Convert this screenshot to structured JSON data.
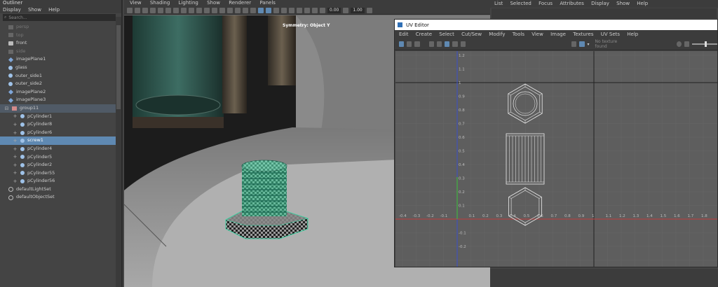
{
  "outliner": {
    "title": "Outliner",
    "menu": [
      "Display",
      "Show",
      "Help"
    ],
    "search_placeholder": "Search...",
    "items": [
      {
        "label": "persp",
        "icon": "camera-icon",
        "state": "dim",
        "indent": 1
      },
      {
        "label": "top",
        "icon": "camera-icon",
        "state": "dim",
        "indent": 1
      },
      {
        "label": "front",
        "icon": "camera-icon",
        "state": "normal",
        "indent": 1
      },
      {
        "label": "side",
        "icon": "camera-icon",
        "state": "dim",
        "indent": 1
      },
      {
        "label": "imagePlane1",
        "icon": "image-plane-icon",
        "state": "normal",
        "indent": 1
      },
      {
        "label": "glass",
        "icon": "mesh-icon",
        "state": "normal",
        "indent": 1
      },
      {
        "label": "outer_side1",
        "icon": "mesh-icon",
        "state": "normal",
        "indent": 1
      },
      {
        "label": "outer_side2",
        "icon": "mesh-icon",
        "state": "normal",
        "indent": 1
      },
      {
        "label": "imagePlane2",
        "icon": "image-plane-icon",
        "state": "normal",
        "indent": 1
      },
      {
        "label": "imagePlane3",
        "icon": "image-plane-icon",
        "state": "normal",
        "indent": 1
      },
      {
        "label": "group11",
        "icon": "group-icon",
        "state": "highlight",
        "indent": 0
      },
      {
        "label": "pCylinder1",
        "icon": "mesh-icon",
        "state": "normal",
        "indent": 2
      },
      {
        "label": "pCylinder8",
        "icon": "mesh-icon",
        "state": "normal",
        "indent": 2
      },
      {
        "label": "pCylinder6",
        "icon": "mesh-icon",
        "state": "normal",
        "indent": 2
      },
      {
        "label": "screw1",
        "icon": "mesh-icon",
        "state": "selected",
        "indent": 2
      },
      {
        "label": "pCylinder4",
        "icon": "mesh-icon",
        "state": "normal",
        "indent": 2
      },
      {
        "label": "pCylinder5",
        "icon": "mesh-icon",
        "state": "normal",
        "indent": 2
      },
      {
        "label": "pCylinder2",
        "icon": "mesh-icon",
        "state": "normal",
        "indent": 2
      },
      {
        "label": "pCylinder55",
        "icon": "mesh-icon",
        "state": "normal",
        "indent": 2
      },
      {
        "label": "pCylinder56",
        "icon": "mesh-icon",
        "state": "normal",
        "indent": 2
      },
      {
        "label": "defaultLightSet",
        "icon": "set-icon",
        "state": "normal",
        "indent": 1
      },
      {
        "label": "defaultObjectSet",
        "icon": "set-icon",
        "state": "normal",
        "indent": 1
      }
    ]
  },
  "viewport": {
    "menu": [
      "View",
      "Shading",
      "Lighting",
      "Show",
      "Renderer",
      "Panels"
    ],
    "field_a": "0.00",
    "field_b": "1.00",
    "symmetry_label": "Symmetry: Object Y"
  },
  "uv_editor": {
    "title": "UV Editor",
    "menu": [
      "Edit",
      "Create",
      "Select",
      "Cut/Sew",
      "Modify",
      "Tools",
      "View",
      "Image",
      "Textures",
      "UV Sets",
      "Help"
    ],
    "no_texture": "No texture found",
    "x_ticks_neg": [
      "-0.4",
      "-0.3",
      "-0.2",
      "-0.1"
    ],
    "x_ticks_pos": [
      "0.1",
      "0.2",
      "0.3",
      "0.4",
      "0.5",
      "0.6",
      "0.7",
      "0.8",
      "0.9",
      "1",
      "1.1",
      "1.2",
      "1.3",
      "1.4",
      "1.5",
      "1.6",
      "1.7",
      "1.8"
    ],
    "y_ticks_pos": [
      "1.2",
      "1.1",
      "1",
      "0.9",
      "0.8",
      "0.7",
      "0.6",
      "0.5",
      "0.4",
      "0.3",
      "0.2",
      "0.1"
    ],
    "y_ticks_neg": [
      "-0.1",
      "-0.2"
    ]
  },
  "channel_box": {
    "menu": [
      "List",
      "Selected",
      "Focus",
      "Attributes",
      "Display",
      "Show",
      "Help"
    ]
  }
}
